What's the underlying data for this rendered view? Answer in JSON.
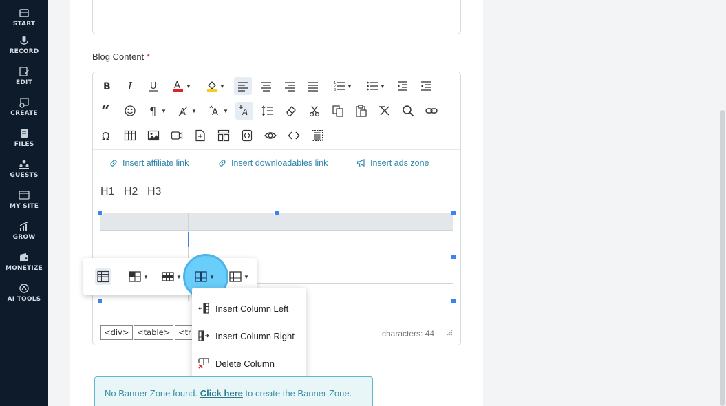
{
  "sidebar": {
    "items": [
      {
        "label": "START",
        "icon": "start-icon"
      },
      {
        "label": "RECORD",
        "icon": "microphone-icon"
      },
      {
        "label": "EDIT",
        "icon": "edit-icon"
      },
      {
        "label": "CREATE",
        "icon": "create-icon"
      },
      {
        "label": "FILES",
        "icon": "files-icon"
      },
      {
        "label": "GUESTS",
        "icon": "guests-icon"
      },
      {
        "label": "MY SITE",
        "icon": "my-site-icon"
      },
      {
        "label": "GROW",
        "icon": "grow-icon"
      },
      {
        "label": "MONETIZE",
        "icon": "monetize-icon"
      },
      {
        "label": "AI TOOLS",
        "icon": "ai-tools-icon"
      }
    ]
  },
  "field": {
    "label": "Blog Content",
    "required_mark": "*"
  },
  "editor": {
    "insert_links": [
      {
        "label": "Insert affiliate link",
        "icon": "link-icon"
      },
      {
        "label": "Insert downloadables link",
        "icon": "link-icon"
      },
      {
        "label": "Insert ads zone",
        "icon": "megaphone-icon"
      }
    ],
    "headings": [
      "H1",
      "H2",
      "H3"
    ],
    "status_tags": [
      "<div>",
      "<table>",
      "<tr>"
    ],
    "char_count": "characters: 44",
    "colors": {
      "text_color": "#e02424",
      "highlight_color": "#facc15",
      "selection": "#3b82f6"
    }
  },
  "column_menu": {
    "items": [
      {
        "label": "Insert Column Left",
        "icon": "insert-column-left-icon"
      },
      {
        "label": "Insert Column Right",
        "icon": "insert-column-right-icon"
      },
      {
        "label": "Delete Column",
        "icon": "delete-column-icon"
      }
    ]
  },
  "banner": {
    "text_before": "No Banner Zone found. ",
    "link": "Click here",
    "text_after": " to create the Banner Zone."
  }
}
